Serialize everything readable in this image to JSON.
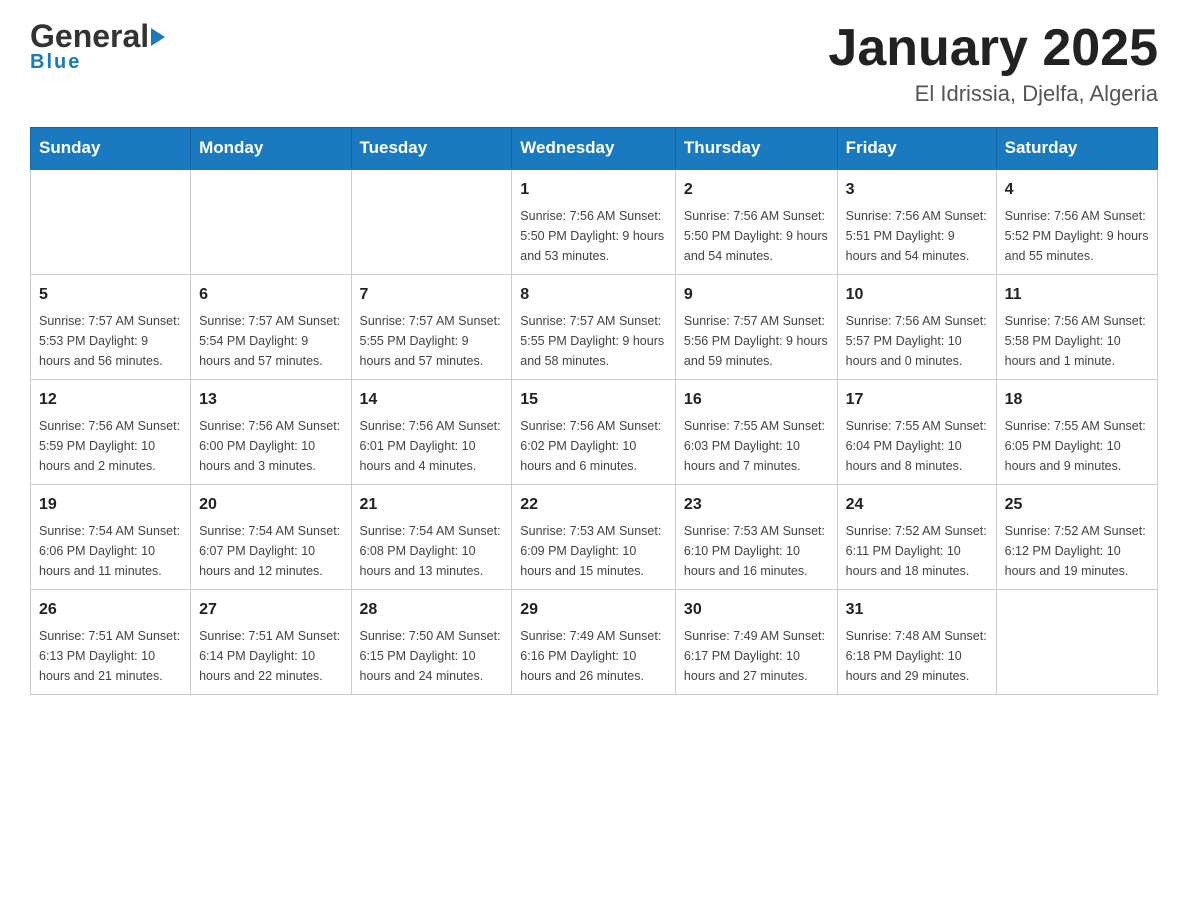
{
  "header": {
    "logo_general": "General",
    "logo_blue": "Blue",
    "title": "January 2025",
    "subtitle": "El Idrissia, Djelfa, Algeria"
  },
  "days_of_week": [
    "Sunday",
    "Monday",
    "Tuesday",
    "Wednesday",
    "Thursday",
    "Friday",
    "Saturday"
  ],
  "weeks": [
    [
      {
        "day": "",
        "info": ""
      },
      {
        "day": "",
        "info": ""
      },
      {
        "day": "",
        "info": ""
      },
      {
        "day": "1",
        "info": "Sunrise: 7:56 AM\nSunset: 5:50 PM\nDaylight: 9 hours\nand 53 minutes."
      },
      {
        "day": "2",
        "info": "Sunrise: 7:56 AM\nSunset: 5:50 PM\nDaylight: 9 hours\nand 54 minutes."
      },
      {
        "day": "3",
        "info": "Sunrise: 7:56 AM\nSunset: 5:51 PM\nDaylight: 9 hours\nand 54 minutes."
      },
      {
        "day": "4",
        "info": "Sunrise: 7:56 AM\nSunset: 5:52 PM\nDaylight: 9 hours\nand 55 minutes."
      }
    ],
    [
      {
        "day": "5",
        "info": "Sunrise: 7:57 AM\nSunset: 5:53 PM\nDaylight: 9 hours\nand 56 minutes."
      },
      {
        "day": "6",
        "info": "Sunrise: 7:57 AM\nSunset: 5:54 PM\nDaylight: 9 hours\nand 57 minutes."
      },
      {
        "day": "7",
        "info": "Sunrise: 7:57 AM\nSunset: 5:55 PM\nDaylight: 9 hours\nand 57 minutes."
      },
      {
        "day": "8",
        "info": "Sunrise: 7:57 AM\nSunset: 5:55 PM\nDaylight: 9 hours\nand 58 minutes."
      },
      {
        "day": "9",
        "info": "Sunrise: 7:57 AM\nSunset: 5:56 PM\nDaylight: 9 hours\nand 59 minutes."
      },
      {
        "day": "10",
        "info": "Sunrise: 7:56 AM\nSunset: 5:57 PM\nDaylight: 10 hours\nand 0 minutes."
      },
      {
        "day": "11",
        "info": "Sunrise: 7:56 AM\nSunset: 5:58 PM\nDaylight: 10 hours\nand 1 minute."
      }
    ],
    [
      {
        "day": "12",
        "info": "Sunrise: 7:56 AM\nSunset: 5:59 PM\nDaylight: 10 hours\nand 2 minutes."
      },
      {
        "day": "13",
        "info": "Sunrise: 7:56 AM\nSunset: 6:00 PM\nDaylight: 10 hours\nand 3 minutes."
      },
      {
        "day": "14",
        "info": "Sunrise: 7:56 AM\nSunset: 6:01 PM\nDaylight: 10 hours\nand 4 minutes."
      },
      {
        "day": "15",
        "info": "Sunrise: 7:56 AM\nSunset: 6:02 PM\nDaylight: 10 hours\nand 6 minutes."
      },
      {
        "day": "16",
        "info": "Sunrise: 7:55 AM\nSunset: 6:03 PM\nDaylight: 10 hours\nand 7 minutes."
      },
      {
        "day": "17",
        "info": "Sunrise: 7:55 AM\nSunset: 6:04 PM\nDaylight: 10 hours\nand 8 minutes."
      },
      {
        "day": "18",
        "info": "Sunrise: 7:55 AM\nSunset: 6:05 PM\nDaylight: 10 hours\nand 9 minutes."
      }
    ],
    [
      {
        "day": "19",
        "info": "Sunrise: 7:54 AM\nSunset: 6:06 PM\nDaylight: 10 hours\nand 11 minutes."
      },
      {
        "day": "20",
        "info": "Sunrise: 7:54 AM\nSunset: 6:07 PM\nDaylight: 10 hours\nand 12 minutes."
      },
      {
        "day": "21",
        "info": "Sunrise: 7:54 AM\nSunset: 6:08 PM\nDaylight: 10 hours\nand 13 minutes."
      },
      {
        "day": "22",
        "info": "Sunrise: 7:53 AM\nSunset: 6:09 PM\nDaylight: 10 hours\nand 15 minutes."
      },
      {
        "day": "23",
        "info": "Sunrise: 7:53 AM\nSunset: 6:10 PM\nDaylight: 10 hours\nand 16 minutes."
      },
      {
        "day": "24",
        "info": "Sunrise: 7:52 AM\nSunset: 6:11 PM\nDaylight: 10 hours\nand 18 minutes."
      },
      {
        "day": "25",
        "info": "Sunrise: 7:52 AM\nSunset: 6:12 PM\nDaylight: 10 hours\nand 19 minutes."
      }
    ],
    [
      {
        "day": "26",
        "info": "Sunrise: 7:51 AM\nSunset: 6:13 PM\nDaylight: 10 hours\nand 21 minutes."
      },
      {
        "day": "27",
        "info": "Sunrise: 7:51 AM\nSunset: 6:14 PM\nDaylight: 10 hours\nand 22 minutes."
      },
      {
        "day": "28",
        "info": "Sunrise: 7:50 AM\nSunset: 6:15 PM\nDaylight: 10 hours\nand 24 minutes."
      },
      {
        "day": "29",
        "info": "Sunrise: 7:49 AM\nSunset: 6:16 PM\nDaylight: 10 hours\nand 26 minutes."
      },
      {
        "day": "30",
        "info": "Sunrise: 7:49 AM\nSunset: 6:17 PM\nDaylight: 10 hours\nand 27 minutes."
      },
      {
        "day": "31",
        "info": "Sunrise: 7:48 AM\nSunset: 6:18 PM\nDaylight: 10 hours\nand 29 minutes."
      },
      {
        "day": "",
        "info": ""
      }
    ]
  ]
}
